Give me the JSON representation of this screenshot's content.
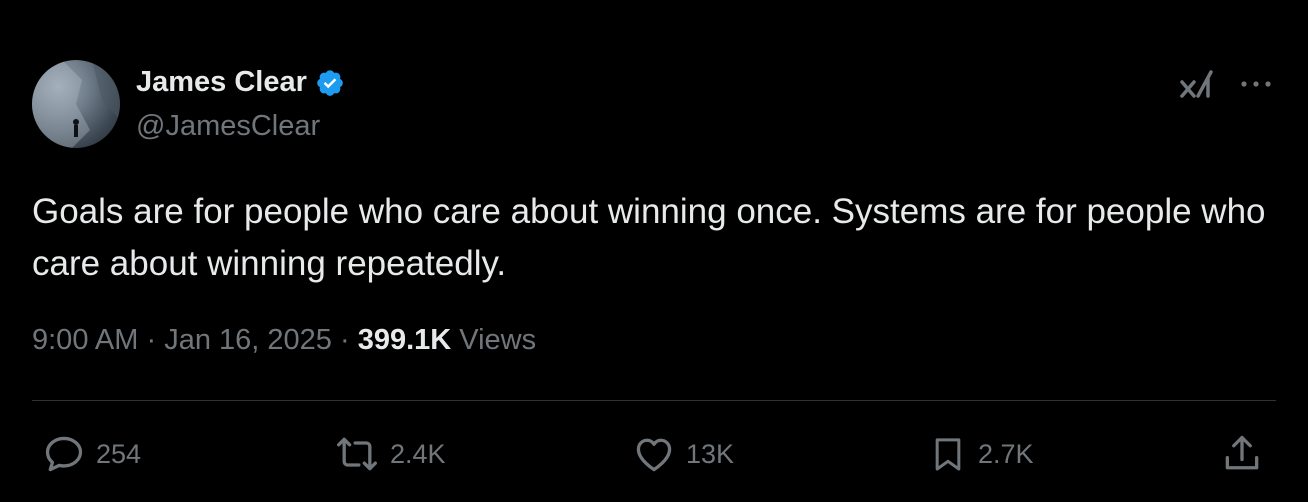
{
  "author": {
    "name": "James Clear",
    "handle": "@JamesClear",
    "verified": true,
    "verified_color": "#1d9bf0"
  },
  "tweet": {
    "text": "Goals are for people who care about winning once. Systems are for people who care about winning repeatedly."
  },
  "meta": {
    "time": "9:00 AM",
    "separator": "·",
    "date": "Jan 16, 2025",
    "views_count": "399.1K",
    "views_label": "Views"
  },
  "actions": {
    "replies": "254",
    "reposts": "2.4K",
    "likes": "13K",
    "bookmarks": "2.7K"
  },
  "icons": [
    "verified-badge-icon",
    "grok-icon",
    "more-icon",
    "reply-icon",
    "repost-icon",
    "like-icon",
    "bookmark-icon",
    "share-icon"
  ],
  "colors": {
    "background": "#000000",
    "text": "#e7e9ea",
    "secondary_text": "#71767b",
    "divider": "#2f3336"
  }
}
